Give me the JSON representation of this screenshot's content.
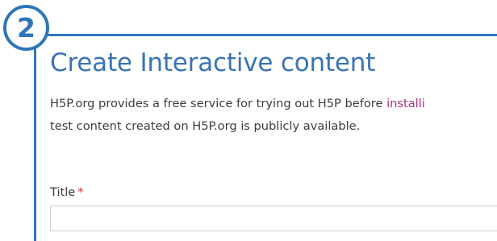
{
  "step": {
    "number": "2"
  },
  "colors": {
    "accent": "#2f76b8",
    "title": "#3a74b5",
    "link": "#a8307a",
    "required": "#d9302c",
    "text": "#3c3c3c"
  },
  "header": {
    "title": "Create Interactive content"
  },
  "description": {
    "line1_text": "H5P.org provides a free service for trying out H5P before ",
    "line1_link": "installi",
    "line2_text": "test content created on H5P.org is publicly available."
  },
  "form": {
    "title_label": "Title",
    "required_mark": "*",
    "title_value": "",
    "title_placeholder": ""
  }
}
